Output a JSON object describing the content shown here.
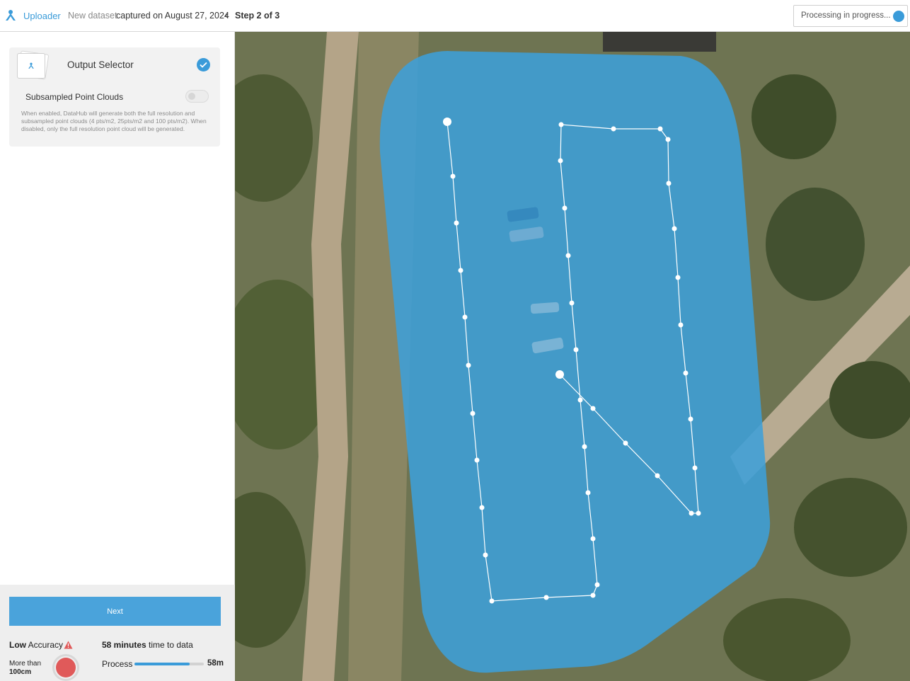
{
  "header": {
    "app_name": "Uploader",
    "dataset_label": "New dataset",
    "captured_text": "captured on August 27, 2024",
    "step_label": "Step 2 of 3",
    "status_text": "Processing in progress..."
  },
  "sidebar": {
    "card": {
      "title": "Output Selector",
      "checked": true,
      "toggle_label": "Subsampled Point Clouds",
      "toggle_on": false,
      "description": "When enabled, DataHub will generate both the full resolution and subsampled point clouds (4 pts/m2, 25pts/m2 and 100 pts/m2). When disabled, only the full resolution point cloud will be generated."
    },
    "next_label": "Next",
    "accuracy": {
      "level": "Low",
      "label": "Accuracy",
      "more_than": "More than",
      "threshold": "100cm"
    },
    "time": {
      "minutes": "58 minutes",
      "suffix": "time to data"
    },
    "process": {
      "label": "Process",
      "value": "58m",
      "progress_fraction": 0.8
    }
  },
  "colors": {
    "accent": "#3a9bd9",
    "coverage": "#3d9fd8",
    "warning": "#e05a5a"
  },
  "icons": [
    "uploader-logo-icon",
    "chevron-left-icon",
    "status-dot-icon",
    "output-selector-icon",
    "checkmark-icon",
    "warning-icon"
  ]
}
